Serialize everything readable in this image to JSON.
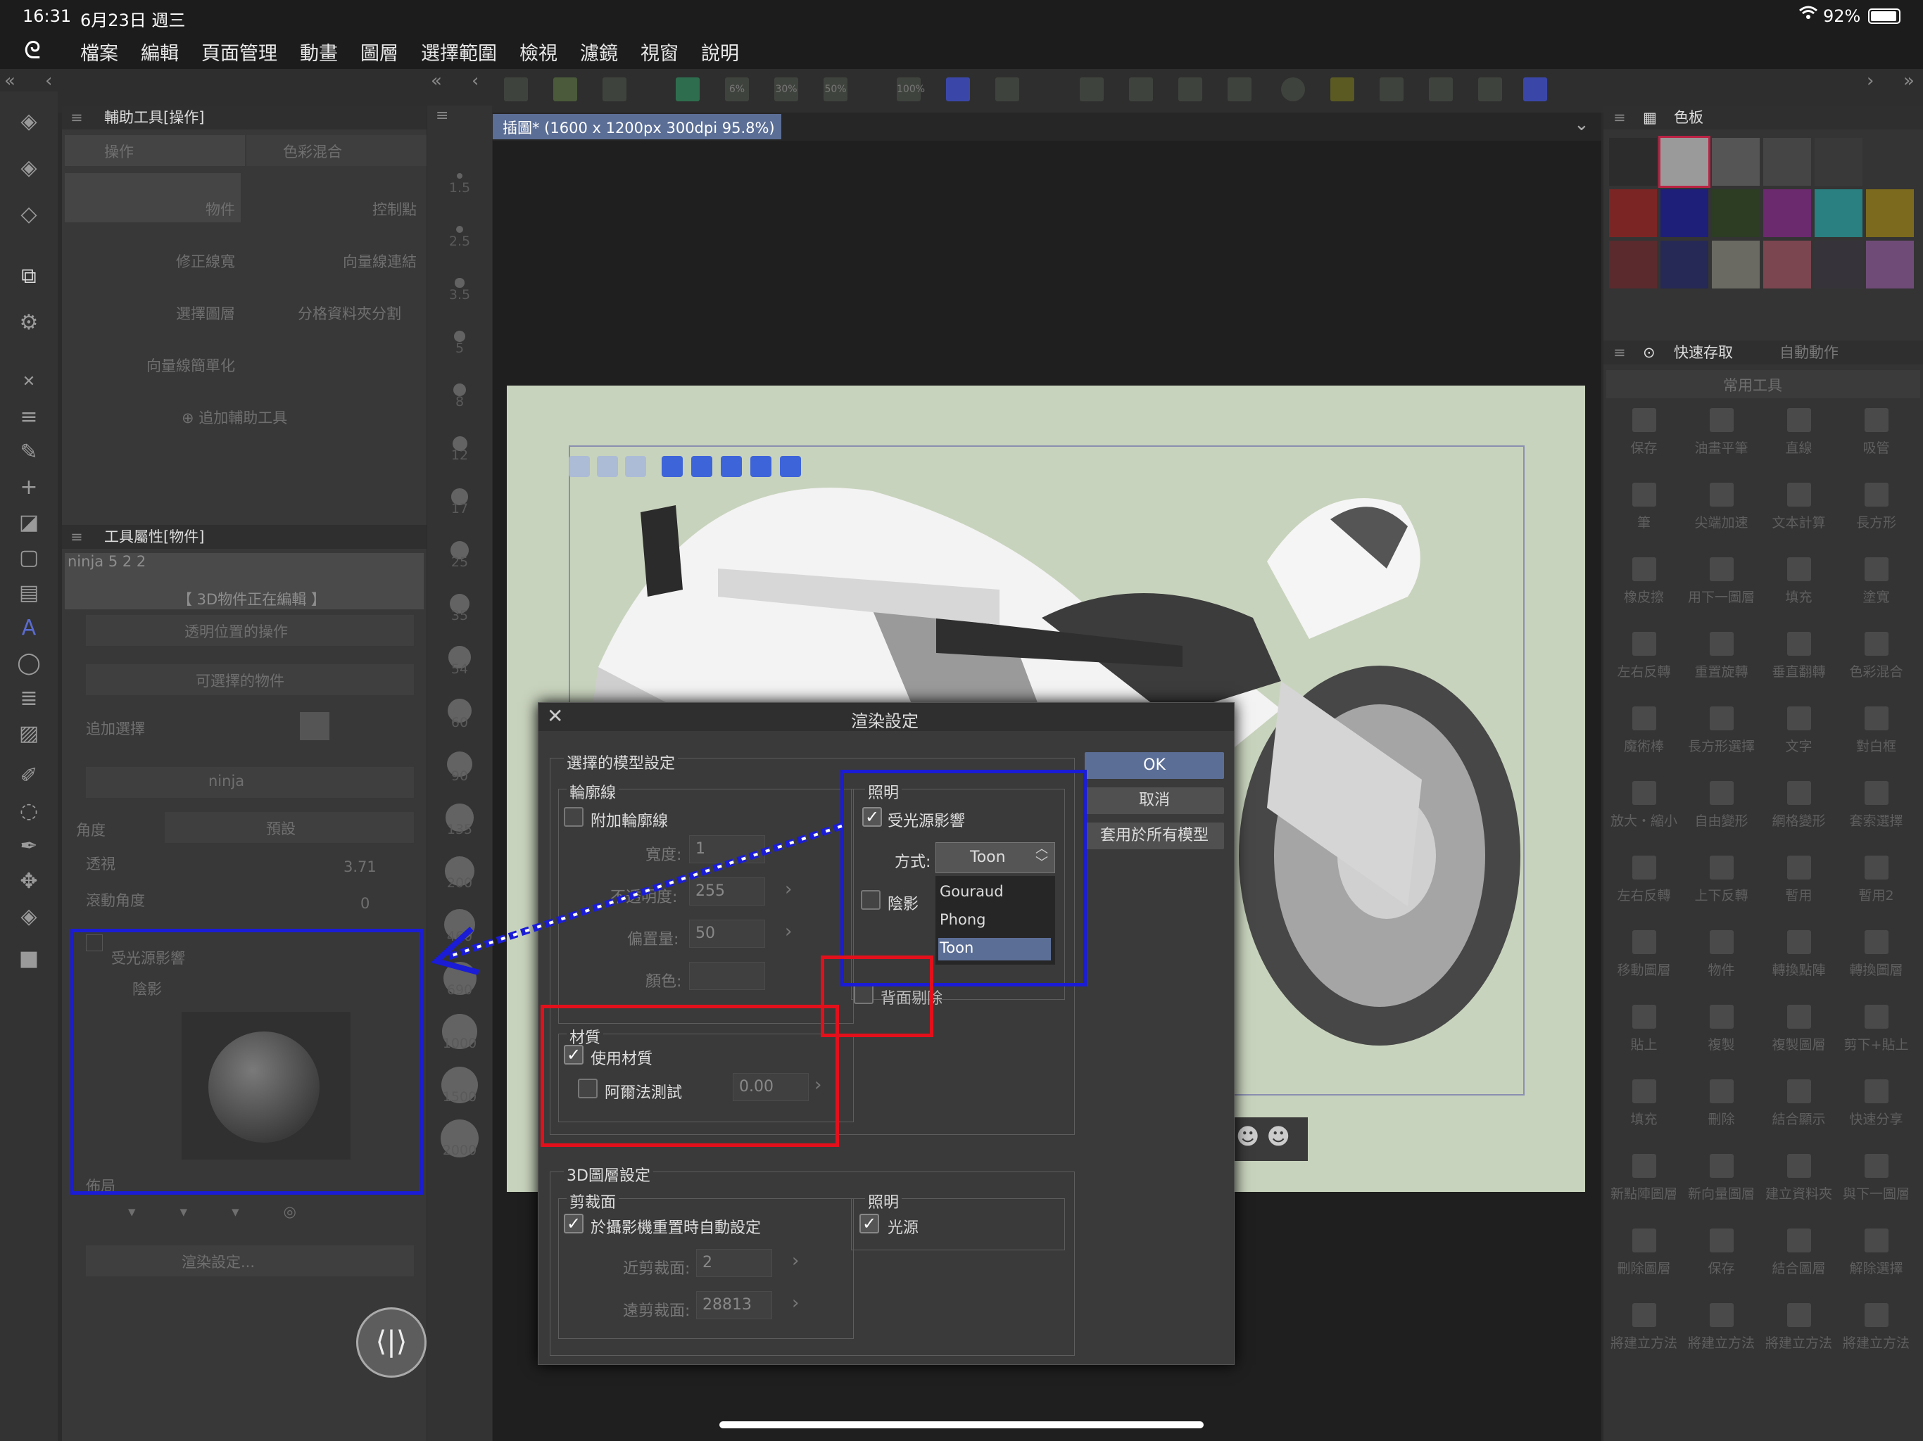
{
  "status": {
    "time": "16:31",
    "date": "6月23日 週三",
    "battery": "92%"
  },
  "menu": [
    "檔案",
    "編輯",
    "頁面管理",
    "動畫",
    "圖層",
    "選擇範圍",
    "檢視",
    "濾鏡",
    "視窗",
    "說明"
  ],
  "subtool_panel": {
    "title": "輔助工具[操作]",
    "tab_operation": "操作",
    "tab_blend": "色彩混合",
    "items": [
      "物件",
      "控制點",
      "修正線寬",
      "向量線連結",
      "選擇圖層",
      "分格資料夾分割",
      "向量線簡單化"
    ],
    "add_label": "追加輔助工具"
  },
  "tool_property": {
    "title": "工具屬性[物件]",
    "preset_name": "ninja 5 2 2",
    "editing_label": "【 3D物件正在編輯 】",
    "transparent_op": "透明位置的操作",
    "selectable_objects": "可選擇的物件",
    "add_selection": "追加選擇",
    "layer_name": "ninja",
    "angle_label": "角度",
    "preset_label": "預設",
    "perspective_label": "透視",
    "perspective_value": "3.71",
    "roll_label": "滾動角度",
    "roll_value": "0",
    "light_affect": "受光源影響",
    "shadow": "陰影",
    "layout_label": "佈局",
    "render_settings": "渲染設定..."
  },
  "brush_sizes": [
    "1.5",
    "2.5",
    "3.5",
    "5",
    "8",
    "12",
    "17",
    "25",
    "35",
    "54",
    "60",
    "90",
    "135",
    "200",
    "460",
    "690",
    "1000",
    "1500",
    "2000"
  ],
  "doc_tab": {
    "title": "插圖* (1600 x 1200px 300dpi 95.8%)"
  },
  "toolbar_icons": [
    "6%",
    "30%",
    "50%",
    "100%"
  ],
  "palette": {
    "title": "色板",
    "colors": [
      "#2c2c2c",
      "#9a9a9a",
      "#555555",
      "#454545",
      "#393939",
      "#343434",
      "#7b2525",
      "#1e1f78",
      "#2c3d24",
      "#6b2a6e",
      "#2a7f80",
      "#7c6a1e",
      "#5a2a2d",
      "#262855",
      "#6a6a63",
      "#7b4650",
      "#37333b",
      "#6f4c78"
    ]
  },
  "quick_access": {
    "tab1": "快速存取",
    "tab2": "自動動作",
    "set_name": "常用工具",
    "items": [
      "保存",
      "油畫平筆",
      "直線",
      "吸管",
      "筆",
      "尖端加速",
      "文本計算",
      "長方形",
      "橡皮擦",
      "用下一圖層",
      "填充",
      "塗寬",
      "左右反轉",
      "重置旋轉",
      "垂直翻轉",
      "色彩混合",
      "魔術棒",
      "長方形選擇",
      "文字",
      "對白框",
      "放大・縮小",
      "自由變形",
      "網格變形",
      "套索選擇",
      "左右反轉",
      "上下反轉",
      "暫用",
      "暫用2",
      "移動圖層",
      "物件",
      "轉換點陣",
      "轉換圖層",
      "貼上",
      "複製",
      "複製圖層",
      "剪下+貼上",
      "填充",
      "刪除",
      "結合顯示",
      "快速分享",
      "新點陣圖層",
      "新向量圖層",
      "建立資料夾",
      "與下一圖層",
      "刪除圖層",
      "保存",
      "結合圖層",
      "解除選擇",
      "將建立方法",
      "將建立方法",
      "將建立方法",
      "將建立方法"
    ]
  },
  "dialog": {
    "title": "渲染設定",
    "ok": "OK",
    "cancel": "取消",
    "apply_all": "套用於所有模型",
    "model_group": "選擇的模型設定",
    "outline_group": "輪廓線",
    "add_outline": "附加輪廓線",
    "width_label": "寬度:",
    "width_value": "1",
    "opacity_label": "不透明度:",
    "opacity_value": "255",
    "offset_label": "偏置量:",
    "offset_value": "50",
    "color_label": "顏色:",
    "lighting_group": "照明",
    "light_affect": "受光源影響",
    "method_label": "方式:",
    "method_value": "Toon",
    "method_options": [
      "Gouraud",
      "Phong",
      "Toon"
    ],
    "shadow": "陰影",
    "backface": "背面剔除",
    "material_group": "材質",
    "use_material": "使用材質",
    "alpha_test": "阿爾法測試",
    "alpha_value": "0.00",
    "layer_group": "3D圖層設定",
    "clip_group": "剪裁面",
    "auto_set": "於攝影機重置時自動設定",
    "near_label": "近剪裁面:",
    "near_value": "2",
    "far_label": "遠剪裁面:",
    "far_value": "28813",
    "layer_light_group": "照明",
    "light_source": "光源"
  },
  "accent": {
    "blue_highlight": "#1a1cd6",
    "red_highlight": "#e3101b",
    "ok_button": "#5b6e96"
  }
}
